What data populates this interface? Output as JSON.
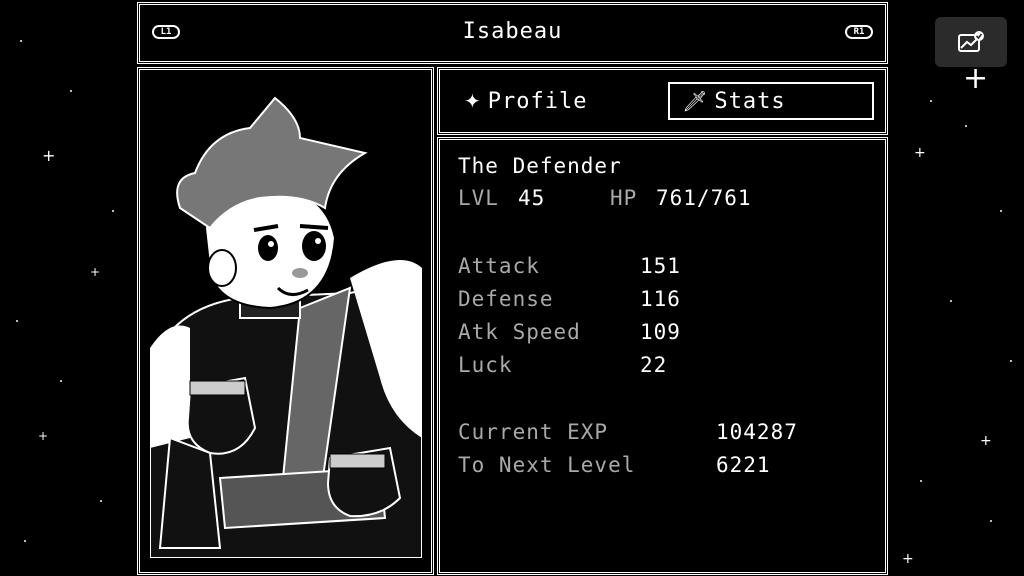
{
  "header": {
    "title": "Isabeau",
    "left_shoulder": "L1",
    "right_shoulder": "R1"
  },
  "tabs": {
    "profile": {
      "label": "Profile",
      "icon": "sparkle-icon"
    },
    "stats": {
      "label": "Stats",
      "icon": "sword-icon",
      "selected": true
    }
  },
  "stats": {
    "class_title": "The Defender",
    "lvl_label": "LVL",
    "lvl_value": "45",
    "hp_label": "HP",
    "hp_value": "761/761",
    "attributes": [
      {
        "label": "Attack",
        "value": "151"
      },
      {
        "label": "Defense",
        "value": "116"
      },
      {
        "label": "Atk Speed",
        "value": "109"
      },
      {
        "label": "Luck",
        "value": "22"
      }
    ],
    "exp": [
      {
        "label": "Current EXP",
        "value": "104287"
      },
      {
        "label": "To Next Level",
        "value": "6221"
      }
    ]
  },
  "overlay": {
    "icon": "gallery-check-icon"
  },
  "colors": {
    "background": "#000000",
    "text": "#ffffff",
    "muted": "#a9a9a9"
  }
}
